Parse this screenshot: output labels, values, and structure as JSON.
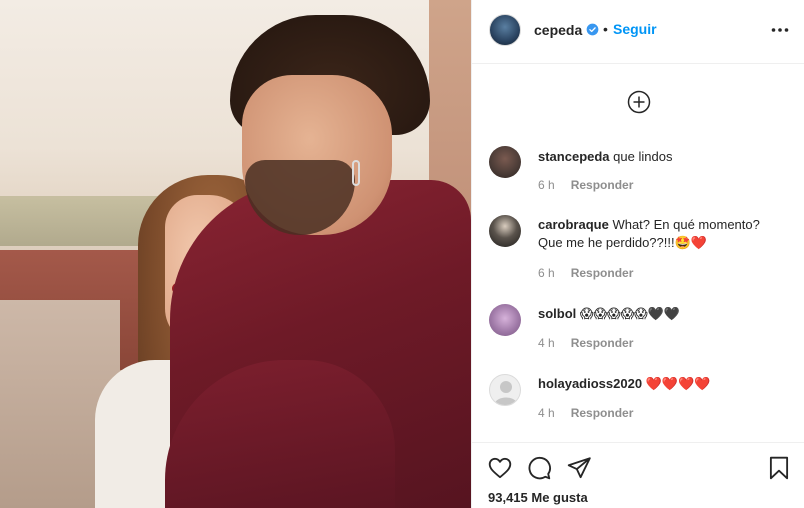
{
  "post": {
    "author": "cepeda",
    "follow_label": "Seguir",
    "separator": "•",
    "likes_text": "93,415 Me gusta"
  },
  "comments": [
    {
      "user": "stancepeda",
      "text": "que lindos",
      "time": "6 h",
      "reply": "Responder",
      "avatar_color": "#4a3b36"
    },
    {
      "user": "carobraque",
      "text": "What? En qué momento? Que me he perdido??!!!🤩❤️",
      "time": "6 h",
      "reply": "Responder",
      "avatar_color": "#2d2b29"
    },
    {
      "user": "solbol",
      "text": "😱😱😱😱😱🖤🖤",
      "time": "4 h",
      "reply": "Responder",
      "avatar_color": "#a07aa8"
    },
    {
      "user": "holayadioss2020",
      "text": "❤️❤️❤️❤️",
      "time": "4 h",
      "reply": "Responder",
      "avatar_color": "#dbdbdb"
    }
  ],
  "icons": {
    "verified": "verified-badge-icon",
    "more": "more-options-icon",
    "load_more": "plus-circle-icon",
    "like": "heart-icon",
    "comment": "comment-icon",
    "share": "paper-plane-icon",
    "save": "bookmark-icon"
  },
  "colors": {
    "accent": "#0095f6",
    "text": "#262626",
    "muted": "#8e8e8e",
    "shirt": "#6e1a27"
  }
}
